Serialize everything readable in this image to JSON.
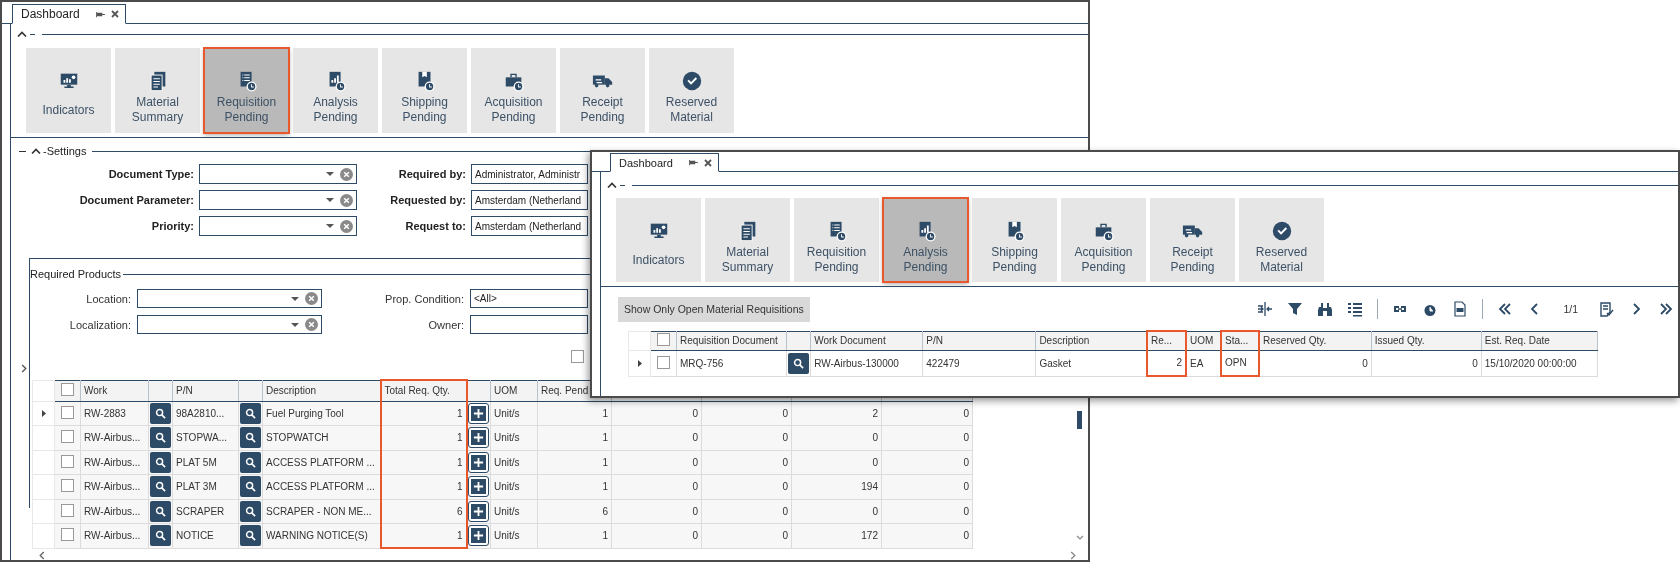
{
  "back_window": {
    "tab": {
      "title": "Dashboard"
    },
    "tiles": [
      {
        "label": "Indicators",
        "kind": "monitor",
        "selected": false
      },
      {
        "label": "Material Summary",
        "kind": "summary",
        "selected": false
      },
      {
        "label": "Requisition Pending",
        "kind": "requisition",
        "selected": true
      },
      {
        "label": "Analysis Pending",
        "kind": "analysis",
        "selected": false
      },
      {
        "label": "Shipping Pending",
        "kind": "shipping",
        "selected": false
      },
      {
        "label": "Acquisition Pending",
        "kind": "acquisition",
        "selected": false
      },
      {
        "label": "Receipt Pending",
        "kind": "receipt",
        "selected": false
      },
      {
        "label": "Reserved Material",
        "kind": "reserved",
        "selected": false
      }
    ],
    "settings": {
      "title": "-Settings",
      "fields": [
        {
          "label": "Document Type:",
          "kind": "combo"
        },
        {
          "label": "Required by:",
          "kind": "text",
          "value": "Administrator, Administr"
        },
        {
          "label": "Document Parameter:",
          "kind": "combo"
        },
        {
          "label": "Requested by:",
          "kind": "text",
          "value": "Amsterdam (Netherland"
        },
        {
          "label": "Priority:",
          "kind": "combo"
        },
        {
          "label": "Request to:",
          "kind": "text",
          "value": "Amsterdam (Netherland"
        }
      ]
    },
    "required_products": {
      "title": "Required Products",
      "fields": [
        {
          "label": "Location:",
          "kind": "combo"
        },
        {
          "label": "Prop. Condition:",
          "kind": "text",
          "value": "<All>"
        },
        {
          "label": "Localization:",
          "kind": "combo"
        },
        {
          "label": "Owner:",
          "kind": "text"
        }
      ],
      "option_checkbox": {
        "checked": false
      }
    },
    "table": {
      "all_checked": false,
      "columns": [
        {
          "header": "Work",
          "kind": "text",
          "highlighted": false
        },
        {
          "kind": "lookup"
        },
        {
          "header": "P/N",
          "kind": "text",
          "highlighted": false
        },
        {
          "kind": "lookup"
        },
        {
          "header": "Description",
          "kind": "text",
          "highlighted": false
        },
        {
          "header": "Total Req. Qty.",
          "kind": "number",
          "highlighted": true
        },
        {
          "kind": "add"
        },
        {
          "header": "UOM",
          "kind": "text",
          "highlighted": false
        },
        {
          "header": "Req. Pend",
          "kind": "number",
          "highlighted": false
        },
        {
          "kind": "number",
          "highlighted": false
        },
        {
          "kind": "number",
          "highlighted": false
        },
        {
          "kind": "number",
          "highlighted": false
        },
        {
          "kind": "number",
          "highlighted": false
        }
      ],
      "rows": [
        {
          "current": true,
          "checked": false,
          "cells": [
            "RW-2883",
            "",
            "98A2810...",
            "",
            "Fuel Purging Tool",
            "1",
            "",
            "Unit/s",
            "1",
            "0",
            "0",
            "2",
            "0"
          ]
        },
        {
          "current": false,
          "checked": false,
          "cells": [
            "RW-Airbus...",
            "",
            "STOPWA...",
            "",
            "STOPWATCH",
            "1",
            "",
            "Unit/s",
            "1",
            "0",
            "0",
            "0",
            "0"
          ]
        },
        {
          "current": false,
          "checked": false,
          "cells": [
            "RW-Airbus...",
            "",
            "PLAT 5M",
            "",
            "ACCESS PLATFORM ...",
            "1",
            "",
            "Unit/s",
            "1",
            "0",
            "0",
            "0",
            "0"
          ]
        },
        {
          "current": false,
          "checked": false,
          "cells": [
            "RW-Airbus...",
            "",
            "PLAT 3M",
            "",
            "ACCESS PLATFORM ...",
            "1",
            "",
            "Unit/s",
            "1",
            "0",
            "0",
            "194",
            "0"
          ]
        },
        {
          "current": false,
          "checked": false,
          "cells": [
            "RW-Airbus...",
            "",
            "SCRAPER",
            "",
            "SCRAPER - NON ME...",
            "6",
            "",
            "Unit/s",
            "6",
            "0",
            "0",
            "0",
            "0"
          ]
        },
        {
          "current": false,
          "checked": false,
          "cells": [
            "RW-Airbus...",
            "",
            "NOTICE",
            "",
            "WARNING NOTICE(S)",
            "1",
            "",
            "Unit/s",
            "1",
            "0",
            "0",
            "172",
            "0"
          ]
        }
      ]
    }
  },
  "front_window": {
    "tab": {
      "title": "Dashboard"
    },
    "tiles": [
      {
        "label": "Indicators",
        "kind": "monitor",
        "selected": false
      },
      {
        "label": "Material Summary",
        "kind": "summary",
        "selected": false
      },
      {
        "label": "Requisition Pending",
        "kind": "requisition",
        "selected": false
      },
      {
        "label": "Analysis Pending",
        "kind": "analysis",
        "selected": true
      },
      {
        "label": "Shipping Pending",
        "kind": "shipping",
        "selected": false
      },
      {
        "label": "Acquisition Pending",
        "kind": "acquisition",
        "selected": false
      },
      {
        "label": "Receipt Pending",
        "kind": "receipt",
        "selected": false
      },
      {
        "label": "Reserved Material",
        "kind": "reserved",
        "selected": false
      }
    ],
    "toolbar": {
      "button": "Show Only Open Material Requisitions",
      "pager": "1/1"
    },
    "table": {
      "all_checked": false,
      "columns": [
        {
          "header": "Requisition Document",
          "kind": "text",
          "highlighted": false
        },
        {
          "kind": "lookup"
        },
        {
          "header": "Work Document",
          "kind": "text",
          "highlighted": false
        },
        {
          "header": "P/N",
          "kind": "text",
          "highlighted": false
        },
        {
          "header": "Description",
          "kind": "text",
          "highlighted": false
        },
        {
          "header": "Re...",
          "kind": "number",
          "highlighted": true
        },
        {
          "header": "UOM",
          "kind": "text",
          "highlighted": false
        },
        {
          "header": "Sta...",
          "kind": "text",
          "highlighted": true
        },
        {
          "header": "Reserved Qty.",
          "kind": "number",
          "highlighted": false
        },
        {
          "header": "Issued Qty.",
          "kind": "number",
          "highlighted": false
        },
        {
          "header": "Est. Req. Date",
          "kind": "text",
          "highlighted": false
        }
      ],
      "rows": [
        {
          "current": true,
          "checked": false,
          "cells": [
            "MRQ-756",
            "",
            "RW-Airbus-130000",
            "422479",
            "Gasket",
            "2",
            "EA",
            "OPN",
            "0",
            "0",
            "15/10/2020 00:00:00"
          ]
        }
      ]
    }
  }
}
